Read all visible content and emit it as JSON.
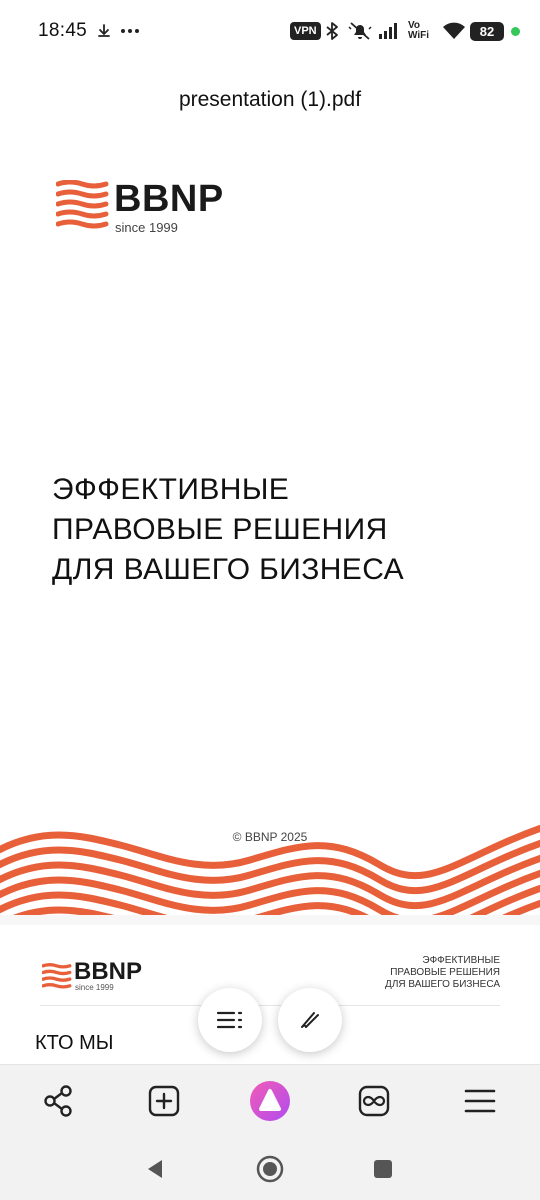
{
  "status_bar": {
    "time": "18:45",
    "download_icon": "download-icon",
    "more_icon": "more-dots-icon",
    "vpn": "VPN",
    "vowifi_top": "Vo",
    "vowifi_bottom": "WiFi",
    "battery": "82"
  },
  "document": {
    "title": "presentation (1).pdf"
  },
  "page1": {
    "logo_word": "BBNP",
    "logo_since": "since  1999",
    "headline_lines": [
      "ЭФФЕКТИВНЫЕ",
      "ПРАВОВЫЕ РЕШЕНИЯ",
      "ДЛЯ ВАШЕГО БИЗНЕСА"
    ],
    "copyright": "© BBNP 2025"
  },
  "page2": {
    "logo_word": "BBNP",
    "logo_since": "since  1999",
    "tagline_lines": [
      "ЭФФЕКТИВНЫЕ",
      "ПРАВОВЫЕ РЕШЕНИЯ",
      "ДЛЯ ВАШЕГО БИЗНЕСА"
    ],
    "section_title": "КТО МЫ"
  },
  "floating": {
    "toc_icon": "table-of-contents-icon",
    "annotate_icon": "pen-icon"
  },
  "toolbar": {
    "share_icon": "share-icon",
    "new_tab_icon": "add-tab-icon",
    "assistant_icon": "alice-assistant-icon",
    "tabs_icon": "tabs-infinity-icon",
    "menu_icon": "hamburger-menu-icon"
  },
  "colors": {
    "brand_orange": "#e8603a",
    "battery_bg": "#222222",
    "assistant_gradient_start": "#f15bb5",
    "assistant_gradient_end": "#b14cf0",
    "status_dot": "#34c759"
  }
}
